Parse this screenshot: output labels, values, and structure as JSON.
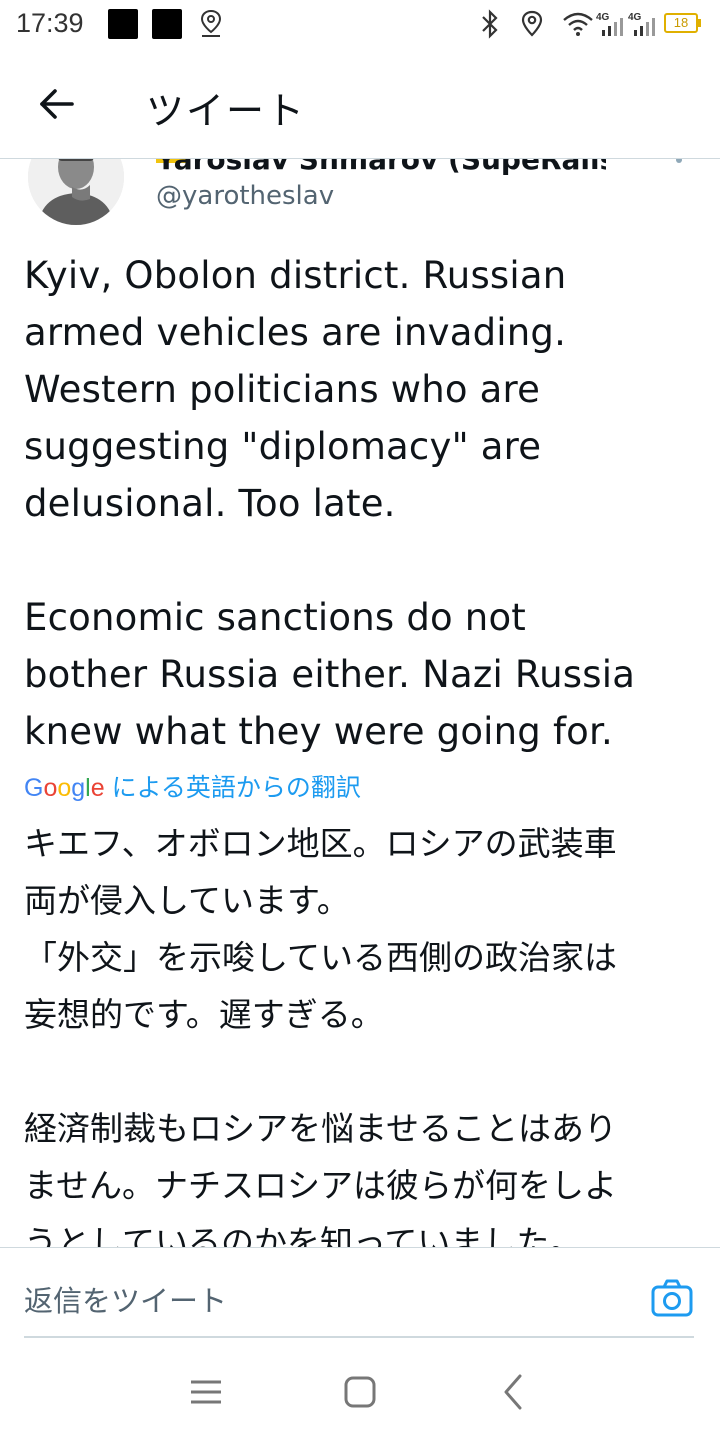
{
  "status_bar": {
    "time": "17:39",
    "battery": "18",
    "network_1": "4G",
    "network_2": "4G",
    "icons": [
      "notification-square-icon",
      "notification-square-icon",
      "location-icon",
      "bluetooth-icon",
      "location-icon",
      "wifi-icon",
      "signal-icon",
      "signal-icon",
      "battery-icon"
    ]
  },
  "header": {
    "title": "ツイート",
    "back_icon": "arrow-left-icon"
  },
  "tweet": {
    "author_name_partial": "Yaroslav Shmarov (SupeRails)",
    "handle": "@yarotheslav",
    "text": "Kyiv, Obolon district. Russian\narmed vehicles are invading.\nWestern politicians who are\nsuggesting \"diplomacy\" are\ndelusional. Too late.\n\nEconomic sanctions do not\nbother Russia either. Nazi Russia\nknew what they were going for.",
    "translation": {
      "provider": "Google",
      "label": "による英語からの翻訳",
      "text": "キエフ、オボロン地区。ロシアの武装車\n両が侵入しています。\n「外交」を示唆している西側の政治家は\n妄想的です。遅すぎる。\n\n経済制裁もロシアを悩ませることはあり\nません。ナチスロシアは彼らが何をしよ\nうとしているのかを知っていました。"
    }
  },
  "reply_bar": {
    "placeholder": "返信をツイート",
    "camera_icon": "camera-icon"
  },
  "colors": {
    "accent": "#1d9bf0",
    "text": "#0f1419",
    "secondary": "#536471",
    "border": "#cfd9de"
  },
  "navbar": {
    "icons": [
      "menu-icon",
      "home-square-icon",
      "back-chevron-icon"
    ]
  }
}
